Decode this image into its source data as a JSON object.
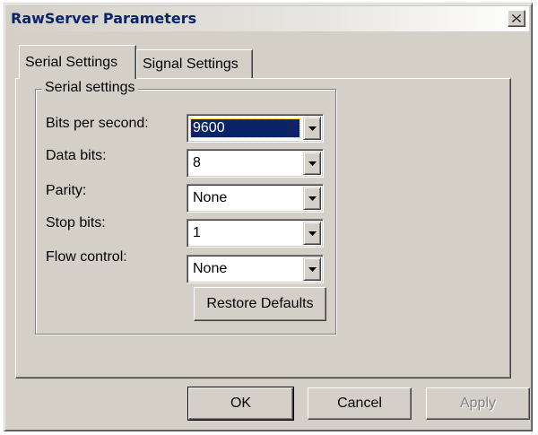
{
  "window": {
    "title": "RawServer Parameters",
    "close_icon": "close-icon"
  },
  "tabs": [
    {
      "label": "Serial Settings",
      "active": true
    },
    {
      "label": "Signal Settings",
      "active": false
    }
  ],
  "group": {
    "legend": "Serial settings",
    "fields": [
      {
        "label": "Bits per second:",
        "value": "9600",
        "selected": true
      },
      {
        "label": "Data bits:",
        "value": "8"
      },
      {
        "label": "Parity:",
        "value": "None"
      },
      {
        "label": "Stop bits:",
        "value": "1"
      },
      {
        "label": "Flow control:",
        "value": "None"
      }
    ],
    "restore_label": "Restore Defaults"
  },
  "buttons": {
    "ok": "OK",
    "cancel": "Cancel",
    "apply": "Apply"
  },
  "colors": {
    "face": "#d4d0c8",
    "selection": "#0a246a",
    "title_text": "#0a246a",
    "disabled_text": "#808080"
  }
}
